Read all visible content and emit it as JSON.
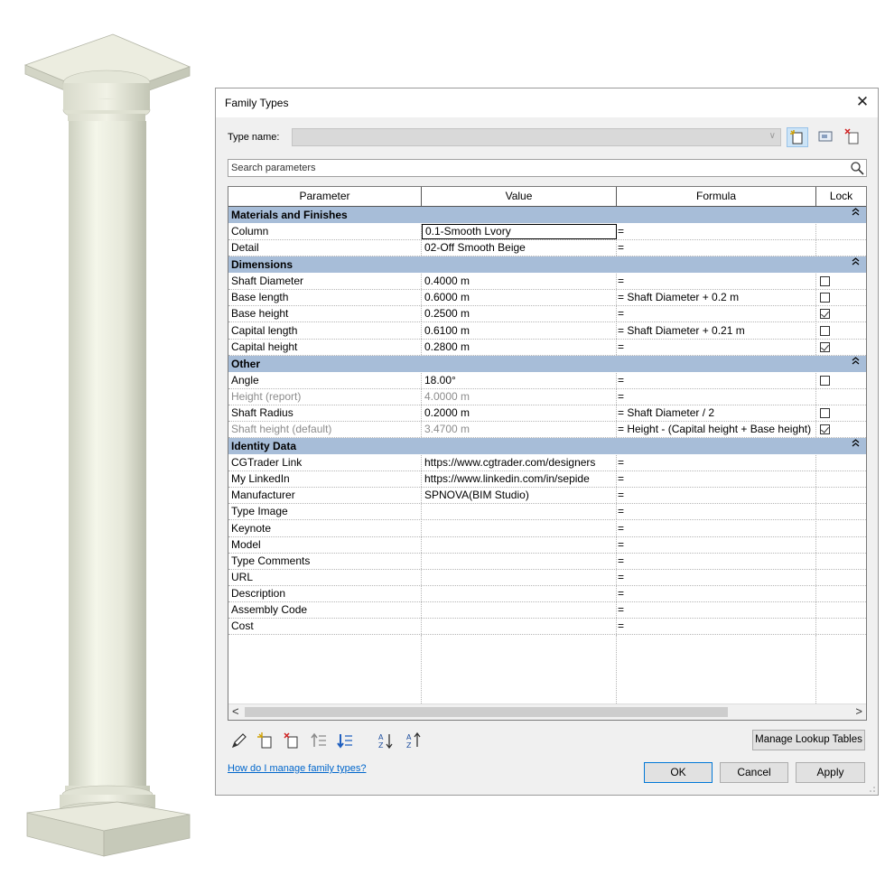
{
  "dialog": {
    "title": "Family Types",
    "type_name_label": "Type name:",
    "type_name_value": "",
    "search_placeholder": "Search parameters",
    "columns": {
      "parameter": "Parameter",
      "value": "Value",
      "formula": "Formula",
      "lock": "Lock"
    },
    "groups": [
      {
        "name": "Materials and Finishes",
        "rows": [
          {
            "parameter": "Column",
            "value": "0.1-Smooth Lvory",
            "formula": "=",
            "lock": null,
            "editing": true
          },
          {
            "parameter": "Detail",
            "value": "02-Off Smooth Beige",
            "formula": "=",
            "lock": null
          }
        ]
      },
      {
        "name": "Dimensions",
        "rows": [
          {
            "parameter": "Shaft Diameter",
            "value": "0.4000 m",
            "formula": "=",
            "lock": false
          },
          {
            "parameter": "Base length",
            "value": "0.6000 m",
            "formula": "= Shaft Diameter + 0.2 m",
            "lock": false
          },
          {
            "parameter": "Base height",
            "value": "0.2500 m",
            "formula": "=",
            "lock": true
          },
          {
            "parameter": "Capital length",
            "value": "0.6100 m",
            "formula": "= Shaft Diameter + 0.21 m",
            "lock": false
          },
          {
            "parameter": "Capital height",
            "value": "0.2800 m",
            "formula": "=",
            "lock": true
          }
        ]
      },
      {
        "name": "Other",
        "rows": [
          {
            "parameter": "Angle",
            "value": "18.00°",
            "formula": "=",
            "lock": false
          },
          {
            "parameter": "Height (report)",
            "value": "4.0000 m",
            "formula": "=",
            "lock": null,
            "dim": true
          },
          {
            "parameter": "Shaft Radius",
            "value": "0.2000 m",
            "formula": "= Shaft Diameter / 2",
            "lock": false
          },
          {
            "parameter": "Shaft height (default)",
            "value": "3.4700 m",
            "formula": "= Height - (Capital height + Base height)",
            "lock": true,
            "dim": true
          }
        ]
      },
      {
        "name": "Identity Data",
        "rows": [
          {
            "parameter": "CGTrader Link",
            "value": "https://www.cgtrader.com/designers",
            "formula": "=",
            "lock": null
          },
          {
            "parameter": "My LinkedIn",
            "value": "https://www.linkedin.com/in/sepide",
            "formula": "=",
            "lock": null
          },
          {
            "parameter": "Manufacturer",
            "value": "SPNOVA(BIM Studio)",
            "formula": "=",
            "lock": null
          },
          {
            "parameter": "Type Image",
            "value": "",
            "formula": "=",
            "lock": null
          },
          {
            "parameter": "Keynote",
            "value": "",
            "formula": "=",
            "lock": null
          },
          {
            "parameter": "Model",
            "value": "",
            "formula": "=",
            "lock": null
          },
          {
            "parameter": "Type Comments",
            "value": "",
            "formula": "=",
            "lock": null
          },
          {
            "parameter": "URL",
            "value": "",
            "formula": "=",
            "lock": null
          },
          {
            "parameter": "Description",
            "value": "",
            "formula": "=",
            "lock": null
          },
          {
            "parameter": "Assembly Code",
            "value": "",
            "formula": "=",
            "lock": null
          },
          {
            "parameter": "Cost",
            "value": "",
            "formula": "=",
            "lock": null
          }
        ]
      }
    ],
    "tools": [
      "edit-pencil-icon",
      "new-parameter-icon",
      "delete-parameter-icon",
      "move-up-icon",
      "move-down-icon",
      "sort-ascending-icon",
      "sort-descending-icon"
    ],
    "manage_lookup_label": "Manage Lookup Tables",
    "help_link": "How do I manage family types?",
    "ok_label": "OK",
    "cancel_label": "Cancel",
    "apply_label": "Apply",
    "group_header_color": "#a7bdd8"
  }
}
